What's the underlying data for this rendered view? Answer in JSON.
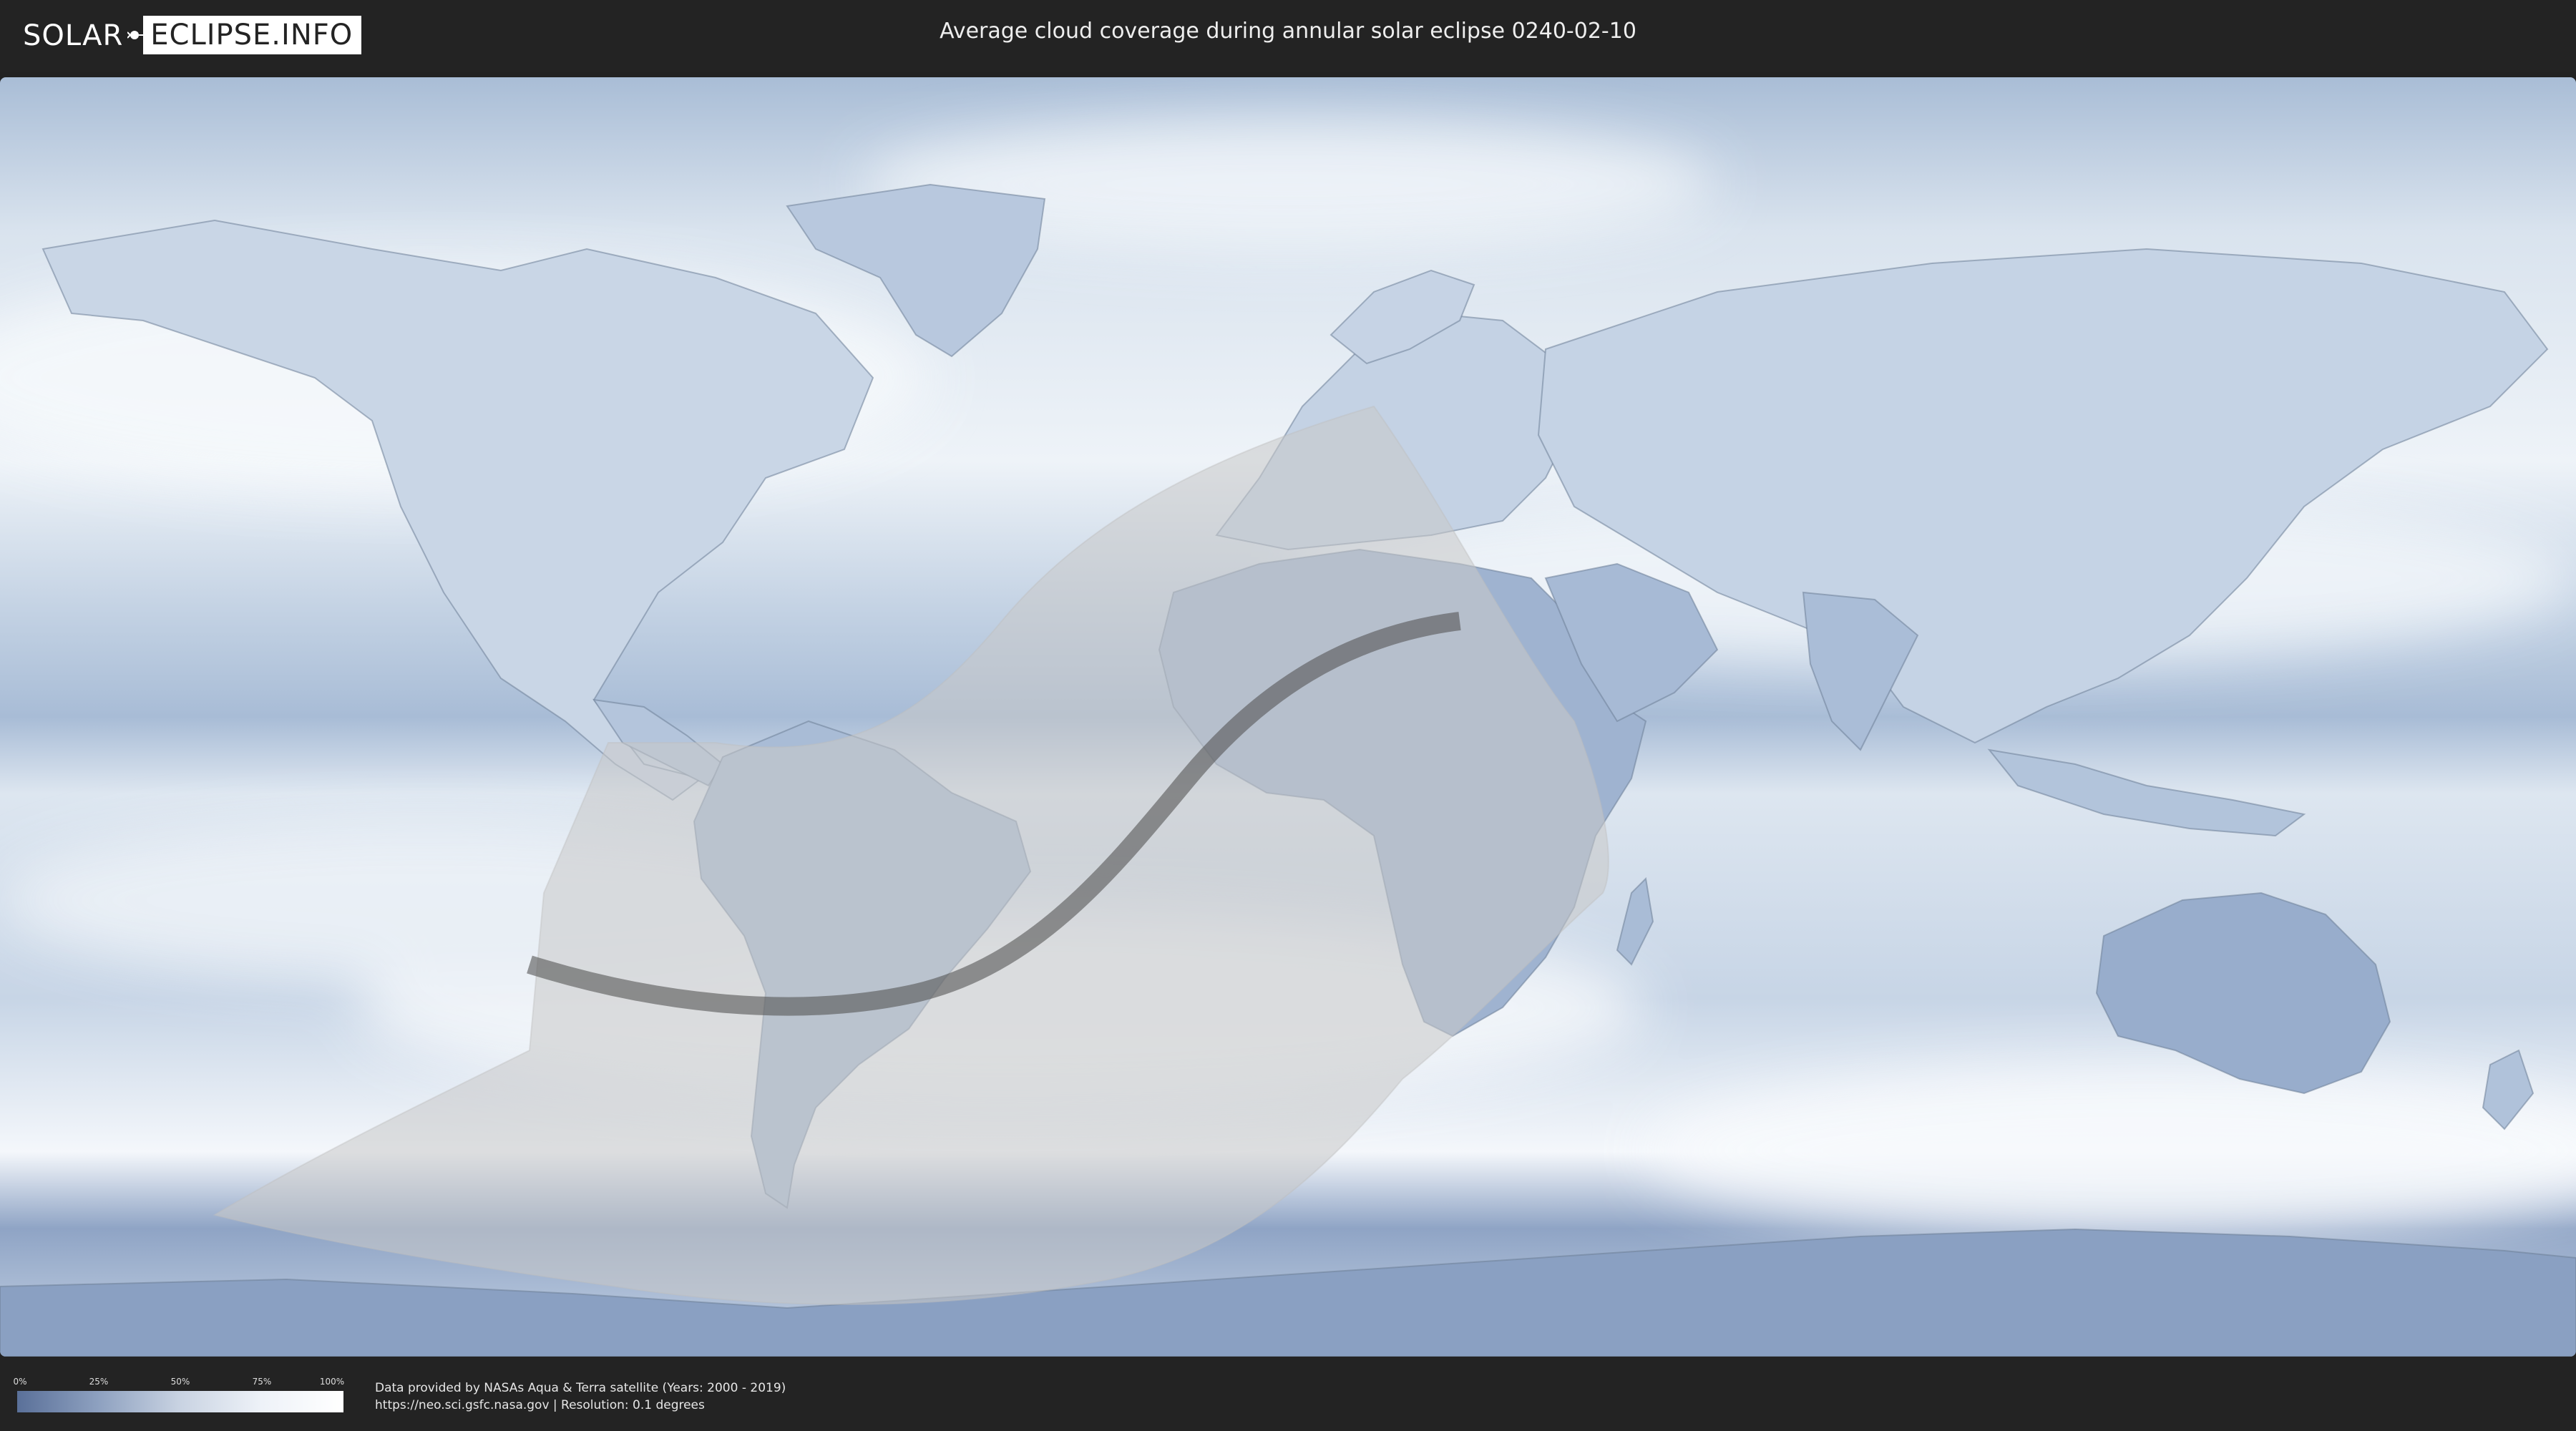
{
  "header": {
    "logo_left": "SOLAR",
    "logo_right": "ECLIPSE.INFO",
    "title": "Average cloud coverage during annular solar eclipse 0240-02-10"
  },
  "map": {
    "type": "world cloud coverage map",
    "projection": "equirectangular",
    "eclipse_type": "annular",
    "date": "0240-02-10",
    "colors": {
      "cloud_min": "#5a7099",
      "cloud_max": "#ffffff",
      "ocean_base": "#b9c9dc",
      "shadow_zone": "#c8c8c8",
      "central_path": "#555555"
    }
  },
  "legend": {
    "ticks": [
      "0%",
      "25%",
      "50%",
      "75%",
      "100%"
    ]
  },
  "footer": {
    "data_credit": "Data provided by NASAs Aqua & Terra satellite (Years: 2000 - 2019)",
    "source_line": "https://neo.sci.gsfc.nasa.gov | Resolution: 0.1 degrees"
  }
}
